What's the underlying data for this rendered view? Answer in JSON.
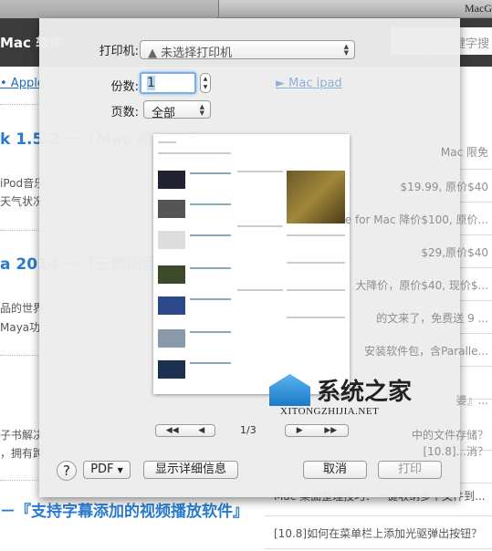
{
  "window": {
    "title": "MacG"
  },
  "site": {
    "name": "Mac 软件",
    "search_placeholder": "输入关键字搜索"
  },
  "breadcrumb": {
    "left_link": "• Apple",
    "right_link": "► Mac ipad"
  },
  "articles": [
    {
      "title": "k 1.5.2 －『Mac 闹钟工具』",
      "line1": "iPod音乐",
      "line2": "天气状况"
    },
    {
      "title": "a 2014 －『三维动画软件』",
      "line1": "品的世界",
      "line2": "Maya功"
    },
    {
      "title": "",
      "line1": "子书解决",
      "line2": "，拥有跨"
    },
    {
      "title": "－『支持字幕添加的视频播放软件』",
      "line1": "",
      "line2": ""
    }
  ],
  "sidebar_list": [
    "Mac 限免",
    "$19.99, 原价$40",
    "e for Mac 降价$100, 原价...",
    "$29,原价$40",
    "大降价，原价$40, 现价$...",
    "的文来了，免费送 9 ...",
    "安装软件包，含Paralle...",
    "",
    "婆』...",
    "中的文件存储？",
    "[10.8]...消？",
    "Mac 桌面整理技巧：一键收纳多个文件到...",
    "[10.8]如何在菜单栏上添加光驱弹出按钮？"
  ],
  "print_dialog": {
    "printer_label": "打印机:",
    "printer_value": "未选择打印机",
    "warning_icon": "warning-triangle",
    "copies_label": "份数:",
    "copies_value": "1",
    "pages_label": "页数:",
    "pages_value": "全部",
    "page_indicator": "1/3",
    "help_label": "?",
    "pdf_label": "PDF",
    "details_label": "显示详细信息",
    "cancel_label": "取消",
    "print_label": "打印"
  },
  "watermark": {
    "cn": "系统之家",
    "en": "XITONGZHIJIA.NET"
  }
}
